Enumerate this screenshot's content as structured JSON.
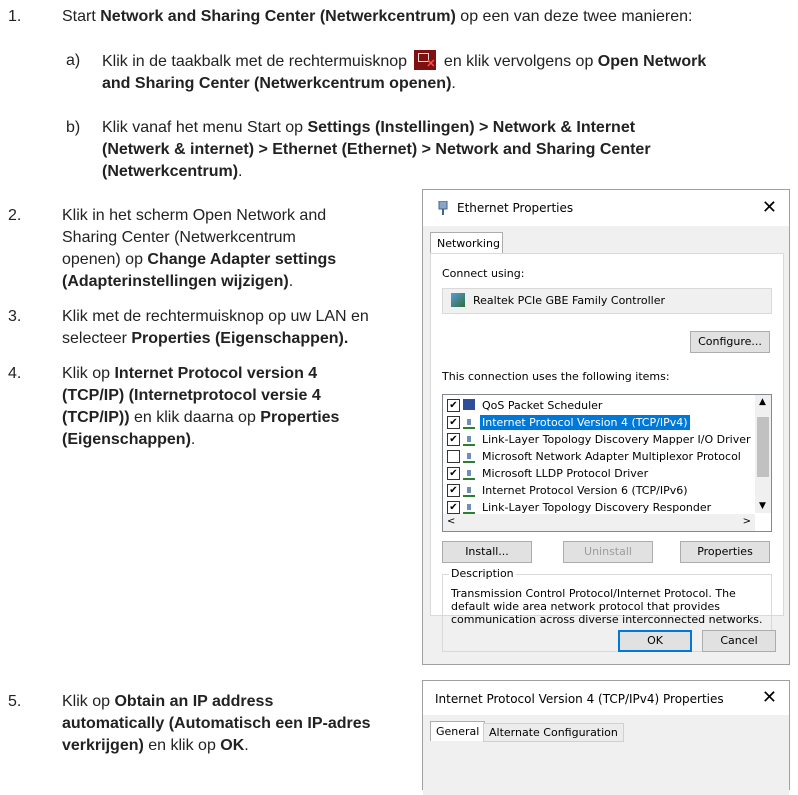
{
  "steps": [
    {
      "num": "1.",
      "pre": "Start ",
      "bold": "Network and Sharing Center (Netwerkcentrum)",
      "post": " op een van deze twee manieren:"
    },
    {
      "num": "2.",
      "line1": "Klik in het scherm Open Network and",
      "line2": "Sharing Center (Netwerkcentrum",
      "line3_pre": "openen) op ",
      "line3_bold": "Change Adapter settings",
      "line4_bold": "(Adapterinstellingen wijzigen)",
      "line4_post": "."
    },
    {
      "num": "3.",
      "line1": "Klik met de rechtermuisknop op uw LAN en",
      "line2_pre": "selecteer  ",
      "line2_bold": "Properties (Eigenschappen)."
    },
    {
      "num": "4.",
      "line1_pre": "Klik op ",
      "line1_bold": "Internet Protocol version 4",
      "line2_bold": "(TCP/IP) (Internetprotocol versie 4",
      "line3_bold": "(TCP/IP))",
      "line3_post": " en klik daarna op ",
      "line3_bold2": "Properties",
      "line4_bold": "(Eigenschappen)",
      "line4_post": "."
    },
    {
      "num": "5.",
      "line1_pre": "Klik op ",
      "line1_bold": "Obtain an IP address",
      "line2_bold": "automatically (Automatisch een IP-adres",
      "line3_bold": "verkrijgen)",
      "line3_post": " en klik op ",
      "line3_bold2": "OK",
      "line3_end": "."
    }
  ],
  "substeps": [
    {
      "label": "a)",
      "pre": "Klik in de taakbalk met de rechtermuisknop ",
      "mid": " en klik vervolgens op ",
      "bold1": "Open Network",
      "bold2": "and Sharing Center (Netwerkcentrum openen)",
      "post": "."
    },
    {
      "label": "b)",
      "pre": "Klik vanaf het menu Start op ",
      "bold1": "Settings (Instellingen) > Network & Internet",
      "bold2": "(Netwerk & internet) > Ethernet (Ethernet) > Network and Sharing Center",
      "bold3": "(Netwerkcentrum)",
      "post": "."
    }
  ],
  "tray_icon": "network-error-icon",
  "dialog": {
    "title": "Ethernet Properties",
    "tab": "Networking",
    "connect_using": "Connect using:",
    "adapter": "Realtek PCIe GBE Family Controller",
    "configure": "Configure...",
    "items_label": "This connection uses the following items:",
    "items": [
      {
        "checked": true,
        "icon": "pc-icon",
        "label": "QoS Packet Scheduler",
        "selected": false
      },
      {
        "checked": true,
        "icon": "network-protocol-icon",
        "label": "Internet Protocol Version 4 (TCP/IPv4)",
        "selected": true
      },
      {
        "checked": true,
        "icon": "network-protocol-icon",
        "label": "Link-Layer Topology Discovery Mapper I/O Driver",
        "selected": false
      },
      {
        "checked": false,
        "icon": "network-protocol-icon",
        "label": "Microsoft Network Adapter Multiplexor Protocol",
        "selected": false
      },
      {
        "checked": true,
        "icon": "network-protocol-icon",
        "label": "Microsoft LLDP Protocol Driver",
        "selected": false
      },
      {
        "checked": true,
        "icon": "network-protocol-icon",
        "label": "Internet Protocol Version 6 (TCP/IPv6)",
        "selected": false
      },
      {
        "checked": true,
        "icon": "network-protocol-icon",
        "label": "Link-Layer Topology Discovery Responder",
        "selected": false
      }
    ],
    "install": "Install...",
    "uninstall": "Uninstall",
    "properties": "Properties",
    "description_label": "Description",
    "description": "Transmission Control Protocol/Internet Protocol. The default wide area network protocol that provides communication across diverse interconnected networks.",
    "ok": "OK",
    "cancel": "Cancel"
  },
  "dialog2": {
    "title": "Internet Protocol Version 4 (TCP/IPv4) Properties",
    "tab_general": "General",
    "tab_alternate": "Alternate Configuration"
  }
}
